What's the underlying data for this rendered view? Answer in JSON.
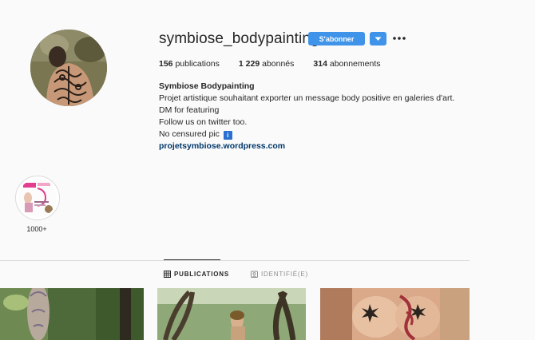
{
  "profile": {
    "username": "symbiose_bodypainting",
    "follow_label": "S'abonner",
    "stats": {
      "posts_count": "156",
      "posts_label": " publications",
      "followers_count": "1 229",
      "followers_label": " abonnés",
      "following_count": "314",
      "following_label": " abonnements"
    },
    "bio": {
      "name": "Symbiose Bodypainting",
      "line1": "Projet artistique souhaitant exporter un message body positive en galeries d'art.",
      "line2": "DM for featuring",
      "line3": "Follow us on twitter too.",
      "line4": "No censured pic",
      "info_badge": "i",
      "link": "projetsymbiose.wordpress.com"
    }
  },
  "highlights": [
    {
      "label": "1000+"
    }
  ],
  "tabs": [
    {
      "label": "PUBLICATIONS",
      "icon": "grid-icon",
      "active": true
    },
    {
      "label": "IDENTIFIÉ(E)",
      "icon": "tag-icon",
      "active": false
    }
  ],
  "colors": {
    "accent": "#3f94ea",
    "link": "#00376b",
    "text": "#262626",
    "muted": "#8e8e8e",
    "border": "#dbdbdb"
  }
}
